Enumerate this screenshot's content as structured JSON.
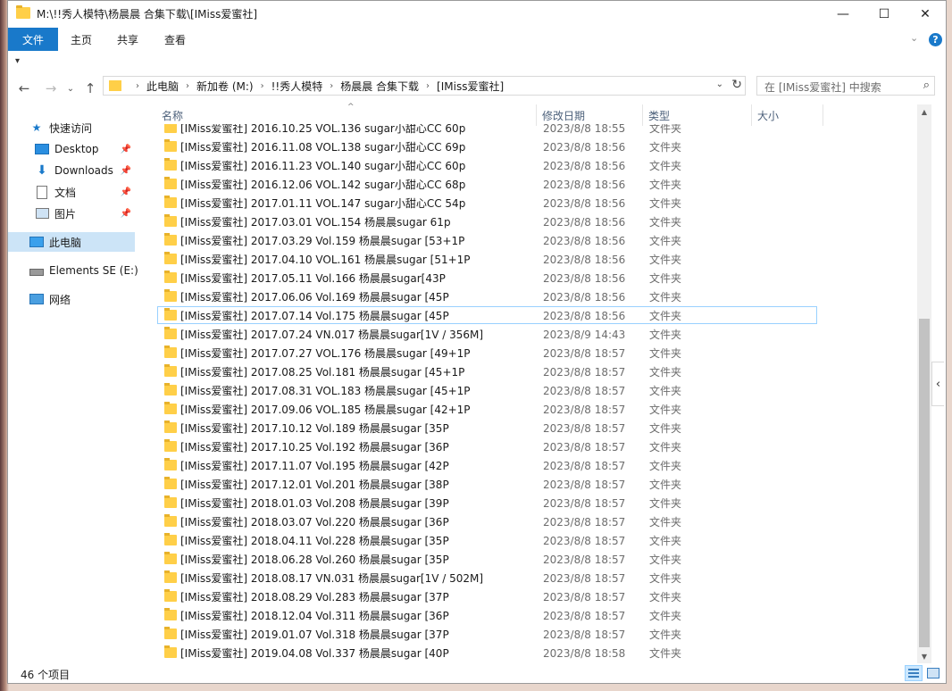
{
  "window": {
    "title": "M:\\!!秀人模特\\杨晨晨 合集下载\\[IMiss爱蜜社]",
    "minimize_glyph": "—",
    "maximize_glyph": "☐",
    "close_glyph": "✕"
  },
  "ribbon": {
    "tabs": [
      "文件",
      "主页",
      "共享",
      "查看"
    ],
    "collapse_glyph": "⌄",
    "help_glyph": "?"
  },
  "qat_glyph": "▾",
  "nav_buttons": {
    "back": "←",
    "forward": "→",
    "recent": "⌄",
    "up": "↑"
  },
  "address": {
    "separator": "›",
    "crumbs": [
      "此电脑",
      "新加卷 (M:)",
      "!!秀人模特",
      "杨晨晨 合集下载",
      "[IMiss爱蜜社]"
    ],
    "dropdown_glyph": "⌄",
    "refresh_glyph": "↻"
  },
  "search": {
    "placeholder": "在 [IMiss爱蜜社] 中搜索",
    "icon": "⌕"
  },
  "nav_pane": {
    "quick_access": "快速访问",
    "desktop": "Desktop",
    "downloads": "Downloads",
    "documents": "文档",
    "pictures": "图片",
    "this_pc": "此电脑",
    "drive": "Elements SE (E:)",
    "network": "网络",
    "pin_glyph": "📌"
  },
  "columns": {
    "name": "名称",
    "date": "修改日期",
    "type": "类型",
    "size": "大小",
    "sort_glyph": "^"
  },
  "files": [
    {
      "name": "[IMiss爱蜜社] 2016.10.25 VOL.136 sugar小甜心CC 60p",
      "date": "2023/8/8 18:55",
      "type": "文件夹"
    },
    {
      "name": "[IMiss爱蜜社] 2016.11.08 VOL.138 sugar小甜心CC 69p",
      "date": "2023/8/8 18:56",
      "type": "文件夹"
    },
    {
      "name": "[IMiss爱蜜社] 2016.11.23 VOL.140 sugar小甜心CC 60p",
      "date": "2023/8/8 18:56",
      "type": "文件夹"
    },
    {
      "name": "[IMiss爱蜜社] 2016.12.06 VOL.142 sugar小甜心CC 68p",
      "date": "2023/8/8 18:56",
      "type": "文件夹"
    },
    {
      "name": "[IMiss爱蜜社] 2017.01.11 VOL.147 sugar小甜心CC 54p",
      "date": "2023/8/8 18:56",
      "type": "文件夹"
    },
    {
      "name": "[IMiss爱蜜社] 2017.03.01 VOL.154 杨晨晨sugar 61p",
      "date": "2023/8/8 18:56",
      "type": "文件夹"
    },
    {
      "name": "[IMiss爱蜜社] 2017.03.29 Vol.159 杨晨晨sugar [53+1P",
      "date": "2023/8/8 18:56",
      "type": "文件夹"
    },
    {
      "name": "[IMiss爱蜜社] 2017.04.10 VOL.161 杨晨晨sugar [51+1P",
      "date": "2023/8/8 18:56",
      "type": "文件夹"
    },
    {
      "name": "[IMiss爱蜜社] 2017.05.11 Vol.166 杨晨晨sugar[43P",
      "date": "2023/8/8 18:56",
      "type": "文件夹"
    },
    {
      "name": "[IMiss爱蜜社] 2017.06.06 Vol.169 杨晨晨sugar [45P",
      "date": "2023/8/8 18:56",
      "type": "文件夹"
    },
    {
      "name": "[IMiss爱蜜社] 2017.07.14 Vol.175 杨晨晨sugar [45P",
      "date": "2023/8/8 18:56",
      "type": "文件夹"
    },
    {
      "name": "[IMiss爱蜜社] 2017.07.24 VN.017 杨晨晨sugar[1V / 356M]",
      "date": "2023/8/9 14:43",
      "type": "文件夹"
    },
    {
      "name": "[IMiss爱蜜社] 2017.07.27 VOL.176 杨晨晨sugar [49+1P",
      "date": "2023/8/8 18:57",
      "type": "文件夹"
    },
    {
      "name": "[IMiss爱蜜社] 2017.08.25 Vol.181 杨晨晨sugar [45+1P",
      "date": "2023/8/8 18:57",
      "type": "文件夹"
    },
    {
      "name": "[IMiss爱蜜社] 2017.08.31 VOL.183 杨晨晨sugar [45+1P",
      "date": "2023/8/8 18:57",
      "type": "文件夹"
    },
    {
      "name": "[IMiss爱蜜社] 2017.09.06 VOL.185 杨晨晨sugar [42+1P",
      "date": "2023/8/8 18:57",
      "type": "文件夹"
    },
    {
      "name": "[IMiss爱蜜社] 2017.10.12 Vol.189 杨晨晨sugar [35P",
      "date": "2023/8/8 18:57",
      "type": "文件夹"
    },
    {
      "name": "[IMiss爱蜜社] 2017.10.25 Vol.192 杨晨晨sugar [36P",
      "date": "2023/8/8 18:57",
      "type": "文件夹"
    },
    {
      "name": "[IMiss爱蜜社] 2017.11.07 Vol.195 杨晨晨sugar [42P",
      "date": "2023/8/8 18:57",
      "type": "文件夹"
    },
    {
      "name": "[IMiss爱蜜社] 2017.12.01 Vol.201 杨晨晨sugar [38P",
      "date": "2023/8/8 18:57",
      "type": "文件夹"
    },
    {
      "name": "[IMiss爱蜜社] 2018.01.03 Vol.208 杨晨晨sugar [39P",
      "date": "2023/8/8 18:57",
      "type": "文件夹"
    },
    {
      "name": "[IMiss爱蜜社] 2018.03.07 Vol.220 杨晨晨sugar [36P",
      "date": "2023/8/8 18:57",
      "type": "文件夹"
    },
    {
      "name": "[IMiss爱蜜社] 2018.04.11 Vol.228 杨晨晨sugar [35P",
      "date": "2023/8/8 18:57",
      "type": "文件夹"
    },
    {
      "name": "[IMiss爱蜜社] 2018.06.28 Vol.260 杨晨晨sugar [35P",
      "date": "2023/8/8 18:57",
      "type": "文件夹"
    },
    {
      "name": "[IMiss爱蜜社] 2018.08.17 VN.031 杨晨晨sugar[1V / 502M]",
      "date": "2023/8/8 18:57",
      "type": "文件夹"
    },
    {
      "name": "[IMiss爱蜜社] 2018.08.29 Vol.283 杨晨晨sugar [37P",
      "date": "2023/8/8 18:57",
      "type": "文件夹"
    },
    {
      "name": "[IMiss爱蜜社] 2018.12.04 Vol.311 杨晨晨sugar [36P",
      "date": "2023/8/8 18:57",
      "type": "文件夹"
    },
    {
      "name": "[IMiss爱蜜社] 2019.01.07 Vol.318 杨晨晨sugar [37P",
      "date": "2023/8/8 18:57",
      "type": "文件夹"
    },
    {
      "name": "[IMiss爱蜜社] 2019.04.08 Vol.337 杨晨晨sugar [40P",
      "date": "2023/8/8 18:58",
      "type": "文件夹"
    }
  ],
  "focused_index": 10,
  "scrollbar": {
    "up_glyph": "▲",
    "down_glyph": "▼"
  },
  "details_toggle_glyph": "‹",
  "status": {
    "item_count": "46 个项目"
  },
  "colors": {
    "accent": "#1979ca",
    "selection": "#cce4f7",
    "folder": "#ffcf48"
  }
}
